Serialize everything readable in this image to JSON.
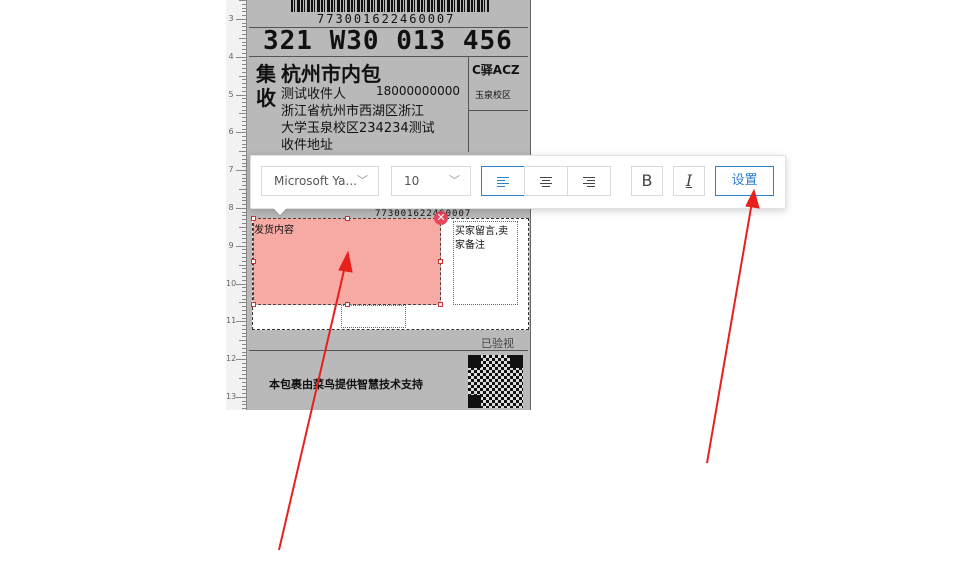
{
  "label": {
    "barcode_number": "773001622460007",
    "big_code": "321 W30 013 456",
    "recipient_tag": "集",
    "collect_tag": "收",
    "destination": "杭州市内包",
    "station_code": "C驿ACZ",
    "station_area": "玉泉校区",
    "recipient_line1": "测试收件人",
    "recipient_phone": "18000000000",
    "address_line1": "浙江省杭州市西湖区浙江",
    "address_line2": "大学玉泉校区234234测试",
    "address_line3": "收件地址",
    "barcode_number_small": "773001622460007",
    "ship_content_label": "发货内容",
    "buyer_note_label_line1": "买家留言,卖",
    "buyer_note_label_line2": "家备注",
    "inspected": "已验视",
    "footer": "本包裹由菜鸟提供智慧技术支持"
  },
  "ruler": {
    "numbers": [
      "3",
      "4",
      "5",
      "6",
      "7",
      "8",
      "9",
      "10",
      "11",
      "12",
      "13"
    ]
  },
  "toolbar": {
    "font_family": "Microsoft Ya...",
    "font_size": "10",
    "bold_label": "B",
    "italic_label": "I",
    "settings_label": "设置"
  },
  "colors": {
    "selection_fill": "#f7aaa4",
    "accent": "#2f7fd0",
    "arrow": "#e8201c",
    "label_bg": "#b9b9b9"
  }
}
